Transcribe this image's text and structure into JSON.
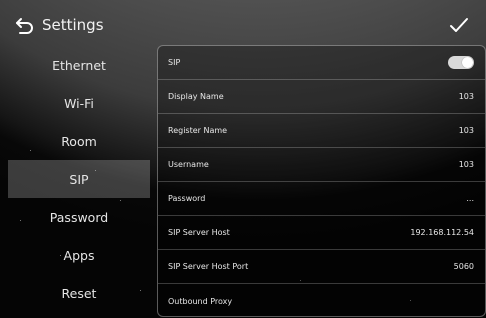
{
  "header": {
    "title": "Settings",
    "back_icon": "back-arrow-icon",
    "confirm_icon": "checkmark-icon"
  },
  "sidebar": {
    "items": [
      {
        "label": "Ethernet"
      },
      {
        "label": "Wi-Fi"
      },
      {
        "label": "Room"
      },
      {
        "label": "SIP",
        "active": true
      },
      {
        "label": "Password"
      },
      {
        "label": "Apps"
      },
      {
        "label": "Reset"
      }
    ]
  },
  "sip": {
    "rows": [
      {
        "label": "SIP",
        "toggle": true,
        "enabled": true
      },
      {
        "label": "Display Name",
        "value": "103"
      },
      {
        "label": "Register Name",
        "value": "103"
      },
      {
        "label": "Username",
        "value": "103"
      },
      {
        "label": "Password",
        "value": "..."
      },
      {
        "label": "SIP Server Host",
        "value": "192.168.112.54"
      },
      {
        "label": "SIP Server Host Port",
        "value": "5060"
      },
      {
        "label": "Outbound Proxy",
        "value": ""
      }
    ]
  },
  "colors": {
    "background": "#050505",
    "active_item": "#5a5a5a",
    "toggle_on": "#d9d9d9"
  }
}
